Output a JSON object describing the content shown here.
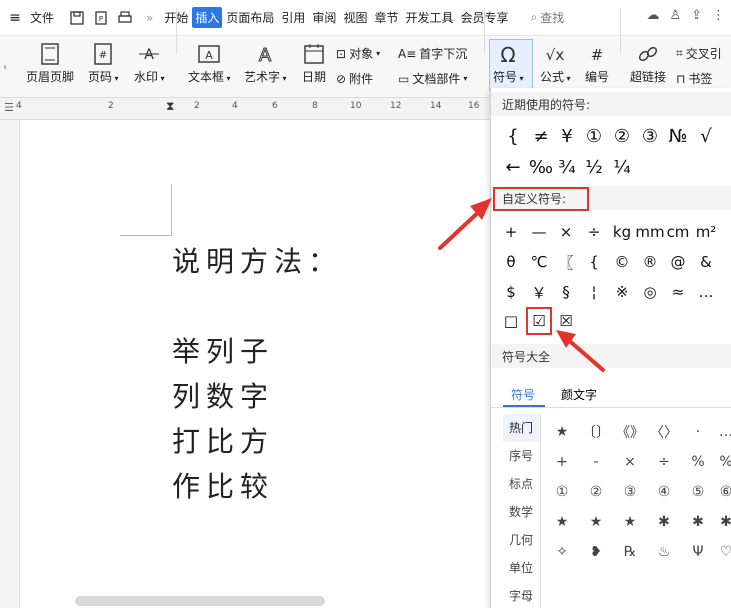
{
  "menubar": {
    "file": "文件",
    "tabs": [
      "开始",
      "插入",
      "页面布局",
      "引用",
      "审阅",
      "视图",
      "章节",
      "开发工具",
      "会员专享"
    ],
    "active_tab": "插入",
    "search": "查找"
  },
  "ribbon": {
    "header_footer": "页眉页脚",
    "page_number": "页码",
    "watermark": "水印",
    "textbox": "文本框",
    "wordart": "艺术字",
    "date": "日期",
    "object": "对象",
    "attachment": "附件",
    "drop_cap": "首字下沉",
    "doc_parts": "文档部件",
    "symbol": "符号",
    "formula": "公式",
    "numbering": "编号",
    "hyperlink": "超链接",
    "bookmark": "书签",
    "cross_ref": "交叉引"
  },
  "ruler": {
    "numbers": [
      "4",
      "2",
      "2",
      "4",
      "6",
      "8",
      "10",
      "12",
      "14",
      "16"
    ]
  },
  "document": {
    "lines": [
      "说明方法：",
      "举列子",
      "列数字",
      "打比方",
      "作比较"
    ]
  },
  "panel": {
    "recent_title": "近期使用的符号:",
    "recent_row1": [
      "{",
      "≠",
      "¥",
      "①",
      "②",
      "③",
      "№",
      "√"
    ],
    "recent_row2": [
      "←",
      "‰",
      "¾",
      "½",
      "¼"
    ],
    "custom_title": "自定义符号:",
    "custom_row1": [
      "+",
      "—",
      "×",
      "÷",
      "kg",
      "mm",
      "cm",
      "m²"
    ],
    "custom_row2": [
      "θ",
      "℃",
      "〖",
      "{",
      "©",
      "®",
      "@",
      "&"
    ],
    "custom_row3": [
      "$",
      "￥",
      "§",
      "¦",
      "※",
      "◎",
      "≈",
      "…"
    ],
    "custom_row4": [
      "□",
      "☑",
      "☒"
    ],
    "all_title": "符号大全",
    "tabs": [
      "符号",
      "颜文字"
    ],
    "categories": [
      "热门",
      "序号",
      "标点",
      "数学",
      "几何",
      "单位",
      "字母"
    ],
    "grid_row1": [
      "★",
      "〔〕",
      "《》",
      "〈〉",
      "·",
      "…"
    ],
    "grid_row2": [
      "+",
      "-",
      "×",
      "÷",
      "%",
      "%"
    ],
    "grid_row3": [
      "①",
      "②",
      "③",
      "④",
      "⑤",
      "⑥"
    ],
    "grid_row4": [
      "★",
      "★",
      "★",
      "✱",
      "✱",
      "✱"
    ],
    "grid_row5": [
      "✧",
      "❥",
      "℞",
      "♨",
      "Ψ",
      "♡"
    ]
  },
  "colors": {
    "accent": "#2b78e4",
    "highlight": "#e5322d"
  }
}
